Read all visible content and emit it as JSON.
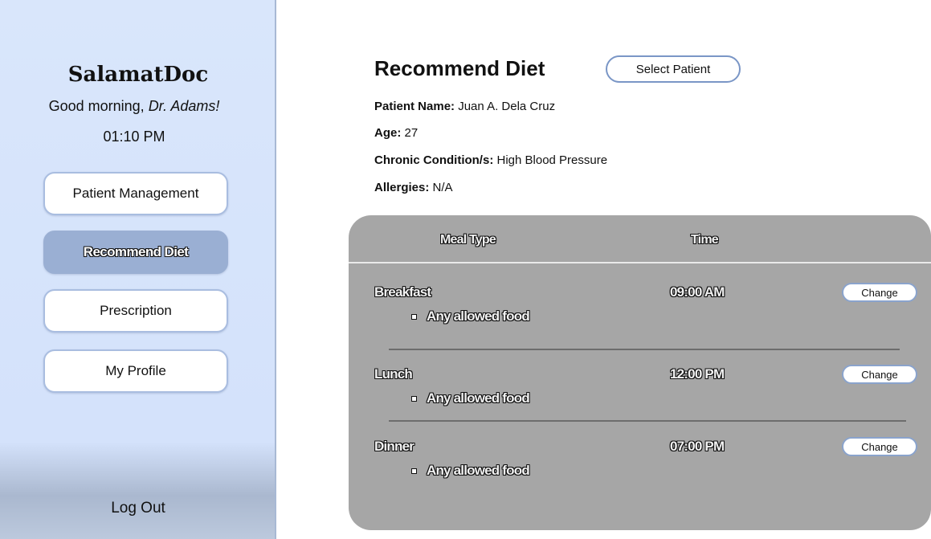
{
  "sidebar": {
    "brand": "SalamatDoc",
    "greeting_prefix": "Good morning, ",
    "greeting_name": "Dr. Adams!",
    "time": "01:10 PM",
    "nav": [
      {
        "label": "Patient Management",
        "active": false
      },
      {
        "label": "Recommend Diet",
        "active": true
      },
      {
        "label": "Prescription",
        "active": false
      },
      {
        "label": "My Profile",
        "active": false
      }
    ],
    "logout_label": "Log Out"
  },
  "main": {
    "title": "Recommend Diet",
    "select_patient_label": "Select Patient",
    "patient": {
      "name_label": "Patient Name:",
      "name_value": "Juan A. Dela Cruz",
      "age_label": "Age:",
      "age_value": "27",
      "condition_label": "Chronic Condition/s:",
      "condition_value": "High Blood Pressure",
      "allergies_label": "Allergies:",
      "allergies_value": "N/A"
    },
    "table": {
      "headers": {
        "meal_type": "Meal Type",
        "time": "Time"
      },
      "rows": [
        {
          "meal": "Breakfast",
          "time": "09:00 AM",
          "food": "Any allowed food",
          "change_label": "Change"
        },
        {
          "meal": "Lunch",
          "time": "12:00 PM",
          "food": "Any allowed food",
          "change_label": "Change"
        },
        {
          "meal": "Dinner",
          "time": "07:00 PM",
          "food": "Any allowed food",
          "change_label": "Change"
        }
      ]
    }
  },
  "colors": {
    "sidebar_bg": "#d4e2fb",
    "active_nav": "#9aafd3",
    "card_bg": "#a6a6a6",
    "button_border": "#7a96c6"
  }
}
